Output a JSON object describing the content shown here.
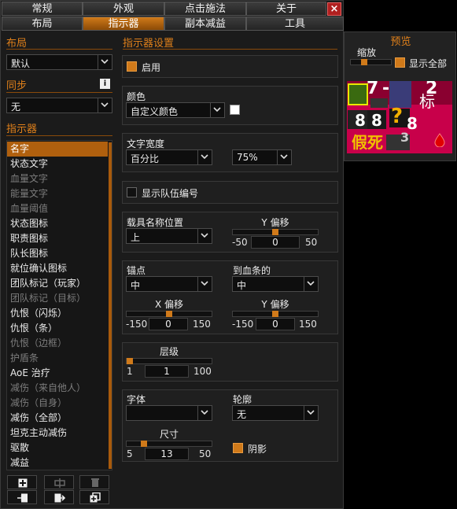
{
  "tabs_row1": [
    "常规",
    "外观",
    "点击施法",
    "关于"
  ],
  "tabs_row2": [
    "布局",
    "指示器",
    "副本减益",
    "工具"
  ],
  "close_label": "×",
  "layout": {
    "header": "布局",
    "value": "默认"
  },
  "sync": {
    "header": "同步",
    "info": "i",
    "value": "无"
  },
  "indicators": {
    "header": "指示器",
    "items": [
      "名字",
      "状态文字",
      "血量文字",
      "能量文字",
      "血量阈值",
      "状态图标",
      "职责图标",
      "队长图标",
      "就位确认图标",
      "团队标记（玩家）",
      "团队标记（目标）",
      "仇恨（闪烁）",
      "仇恨（条）",
      "仇恨（边框）",
      "护盾条",
      "AoE 治疗",
      "减伤（来自他人）",
      "减伤（自身）",
      "减伤（全部）",
      "坦克主动减伤",
      "驱散",
      "减益"
    ]
  },
  "settings": {
    "header": "指示器设置",
    "enable_label": "启用",
    "color_label": "颜色",
    "color_value": "自定义颜色",
    "textwidth_label": "文字宽度",
    "textwidth_value": "百分比",
    "textwidth_pct": "75%",
    "show_group_label": "显示队伍编号",
    "vehicle_label": "载具名称位置",
    "vehicle_value": "上",
    "vehicle_y_label": "Y 偏移",
    "vehicle_y": {
      "min": "-50",
      "value": "0",
      "max": "50"
    },
    "anchor_label": "锚点",
    "anchor_value": "中",
    "relative_label": "到血条的",
    "relative_value": "中",
    "x_offset_label": "X 偏移",
    "x_offset": {
      "min": "-150",
      "value": "0",
      "max": "150"
    },
    "y_offset_label": "Y 偏移",
    "y_offset": {
      "min": "-150",
      "value": "0",
      "max": "150"
    },
    "level_label": "层级",
    "level": {
      "min": "1",
      "value": "1",
      "max": "100"
    },
    "font_label": "字体",
    "font_value": "",
    "outline_label": "轮廓",
    "outline_value": "无",
    "size_label": "尺寸",
    "size": {
      "min": "5",
      "value": "13",
      "max": "50"
    },
    "shadow_label": "阴影"
  },
  "preview": {
    "header": "预览",
    "scale_label": "缩放",
    "show_all_label": "显示全部",
    "texts": [
      "7",
      "-",
      "2",
      "8",
      "8",
      "?",
      "8",
      "假死",
      "3",
      "标"
    ]
  },
  "colors": {
    "accent": "#d07a1a",
    "header": "#e0801a",
    "preview_bg": "#c8004a"
  }
}
